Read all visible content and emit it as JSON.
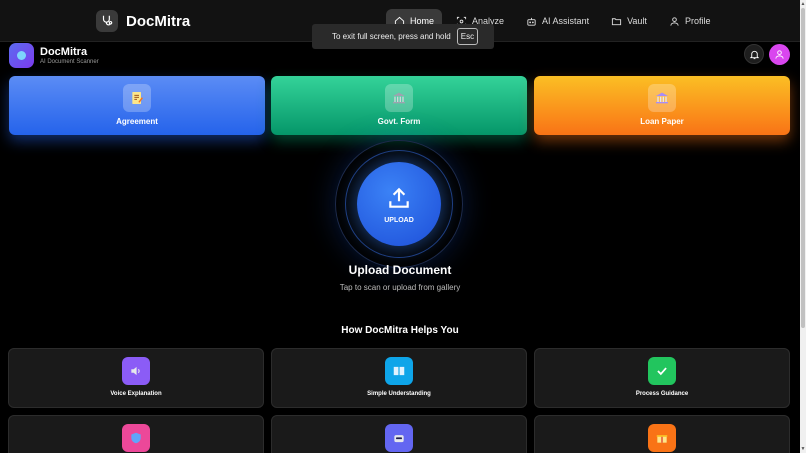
{
  "topnav": {
    "brand": "DocMitra",
    "links": [
      {
        "label": "Home",
        "icon": "home-icon",
        "active": true
      },
      {
        "label": "Analyze",
        "icon": "scan-icon"
      },
      {
        "label": "AI Assistant",
        "icon": "robot-icon"
      },
      {
        "label": "Vault",
        "icon": "folder-icon"
      },
      {
        "label": "Profile",
        "icon": "user-icon"
      }
    ]
  },
  "toast": {
    "text": "To exit full screen, press and hold",
    "key": "Esc"
  },
  "app": {
    "title": "DocMitra",
    "subtitle": "AI Document Scanner"
  },
  "categories": [
    {
      "label": "Agreement",
      "icon": "pencil-document-icon"
    },
    {
      "label": "Govt. Form",
      "icon": "government-building-icon"
    },
    {
      "label": "Loan Paper",
      "icon": "bank-icon"
    }
  ],
  "upload": {
    "button_label": "UPLOAD",
    "title": "Upload Document",
    "subtitle": "Tap to scan or upload from gallery"
  },
  "helps": {
    "title": "How DocMitra Helps You",
    "features": [
      {
        "label": "Voice Explanation",
        "icon": "speaker-icon",
        "color": "#8b5cf6"
      },
      {
        "label": "Simple Understanding",
        "icon": "book-icon",
        "color": "#0ea5e9"
      },
      {
        "label": "Process Guidance",
        "icon": "checkmark-icon",
        "color": "#22c55e"
      },
      {
        "label": "",
        "icon": "shield-icon",
        "color": "#ec4899"
      },
      {
        "label": "",
        "icon": "robot-icon",
        "color": "#6366f1"
      },
      {
        "label": "",
        "icon": "gift-icon",
        "color": "#f97316"
      }
    ]
  },
  "colors": {
    "accent": "#2563eb",
    "background": "#000000"
  }
}
